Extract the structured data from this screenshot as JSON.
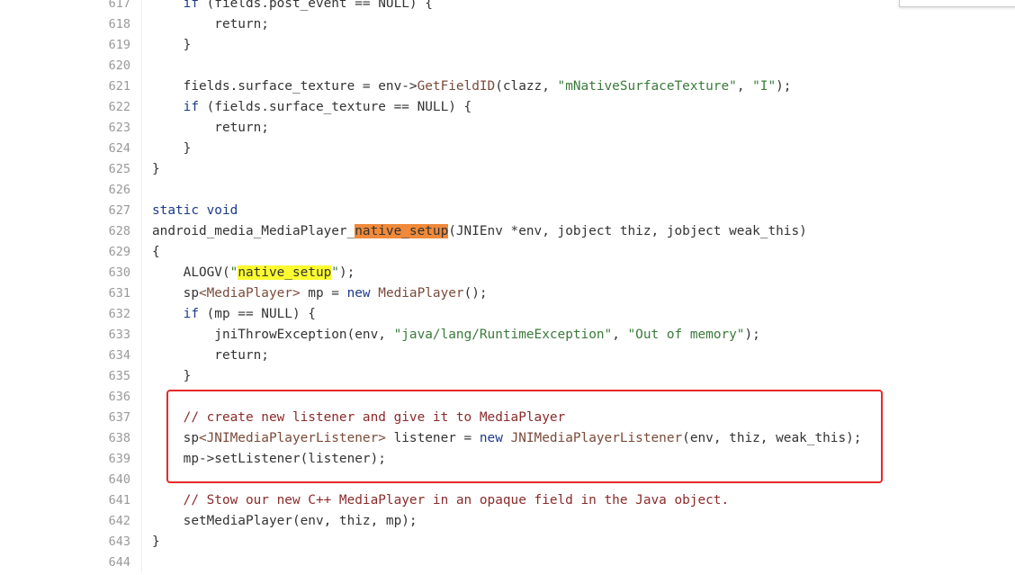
{
  "colors": {
    "highlight_box": "#e8282a",
    "search_current": "#f08a3a",
    "search_match": "#fbfb30"
  },
  "lines": [
    {
      "n": "617",
      "segs": [
        [
          "",
          "    "
        ],
        [
          "kw",
          "if"
        ],
        [
          "",
          " (fields.post_event == NULL) {"
        ]
      ]
    },
    {
      "n": "618",
      "segs": [
        [
          "",
          "        return;"
        ]
      ]
    },
    {
      "n": "619",
      "segs": [
        [
          "",
          "    }"
        ]
      ]
    },
    {
      "n": "620",
      "segs": []
    },
    {
      "n": "621",
      "segs": [
        [
          "",
          "    fields.surface_texture = env->"
        ],
        [
          "typ",
          "GetFieldID"
        ],
        [
          "",
          "(clazz, "
        ],
        [
          "str",
          "\"mNativeSurfaceTexture\""
        ],
        [
          "",
          ", "
        ],
        [
          "str",
          "\"I\""
        ],
        [
          "",
          ");"
        ]
      ]
    },
    {
      "n": "622",
      "segs": [
        [
          "",
          "    "
        ],
        [
          "kw",
          "if"
        ],
        [
          "",
          " (fields.surface_texture == NULL) {"
        ]
      ]
    },
    {
      "n": "623",
      "segs": [
        [
          "",
          "        return;"
        ]
      ]
    },
    {
      "n": "624",
      "segs": [
        [
          "",
          "    }"
        ]
      ]
    },
    {
      "n": "625",
      "segs": [
        [
          "",
          "}"
        ]
      ]
    },
    {
      "n": "626",
      "segs": []
    },
    {
      "n": "627",
      "segs": [
        [
          "kw",
          "static void"
        ]
      ]
    },
    {
      "n": "628",
      "segs": [
        [
          "",
          "android_media_MediaPlayer_"
        ],
        [
          "hlo",
          "native_setup"
        ],
        [
          "",
          "(JNIEnv *env, jobject thiz, jobject weak_this)"
        ]
      ]
    },
    {
      "n": "629",
      "segs": [
        [
          "",
          "{"
        ]
      ]
    },
    {
      "n": "630",
      "segs": [
        [
          "",
          "    ALOGV("
        ],
        [
          "str",
          "\""
        ],
        [
          "hly",
          "native_setup"
        ],
        [
          "str",
          "\""
        ],
        [
          "",
          ");"
        ]
      ]
    },
    {
      "n": "631",
      "segs": [
        [
          "",
          "    sp"
        ],
        [
          "typ",
          "<MediaPlayer>"
        ],
        [
          "",
          " mp = "
        ],
        [
          "kw",
          "new"
        ],
        [
          "",
          " "
        ],
        [
          "typ",
          "MediaPlayer"
        ],
        [
          "",
          "();"
        ]
      ]
    },
    {
      "n": "632",
      "segs": [
        [
          "",
          "    "
        ],
        [
          "kw",
          "if"
        ],
        [
          "",
          " (mp == NULL) {"
        ]
      ]
    },
    {
      "n": "633",
      "segs": [
        [
          "",
          "        jniThrowException(env, "
        ],
        [
          "str",
          "\"java/lang/RuntimeException\""
        ],
        [
          "",
          ", "
        ],
        [
          "str",
          "\"Out of memory\""
        ],
        [
          "",
          ");"
        ]
      ]
    },
    {
      "n": "634",
      "segs": [
        [
          "",
          "        return;"
        ]
      ]
    },
    {
      "n": "635",
      "segs": [
        [
          "",
          "    }"
        ]
      ]
    },
    {
      "n": "636",
      "segs": []
    },
    {
      "n": "637",
      "segs": [
        [
          "com",
          "    // create new listener and give it to MediaPlayer"
        ]
      ]
    },
    {
      "n": "638",
      "segs": [
        [
          "",
          "    sp"
        ],
        [
          "typ",
          "<JNIMediaPlayerListener>"
        ],
        [
          "",
          " listener = "
        ],
        [
          "kw",
          "new"
        ],
        [
          "",
          " "
        ],
        [
          "typ",
          "JNIMediaPlayerListener"
        ],
        [
          "",
          "(env, thiz, weak_this);"
        ]
      ]
    },
    {
      "n": "639",
      "segs": [
        [
          "",
          "    mp->setListener(listener);"
        ]
      ]
    },
    {
      "n": "640",
      "segs": []
    },
    {
      "n": "641",
      "segs": [
        [
          "com",
          "    // Stow our new C++ MediaPlayer in an opaque field in the Java object."
        ]
      ]
    },
    {
      "n": "642",
      "segs": [
        [
          "",
          "    setMediaPlayer(env, thiz, mp);"
        ]
      ]
    },
    {
      "n": "643",
      "segs": [
        [
          "",
          "}"
        ]
      ]
    },
    {
      "n": "644",
      "segs": []
    }
  ]
}
